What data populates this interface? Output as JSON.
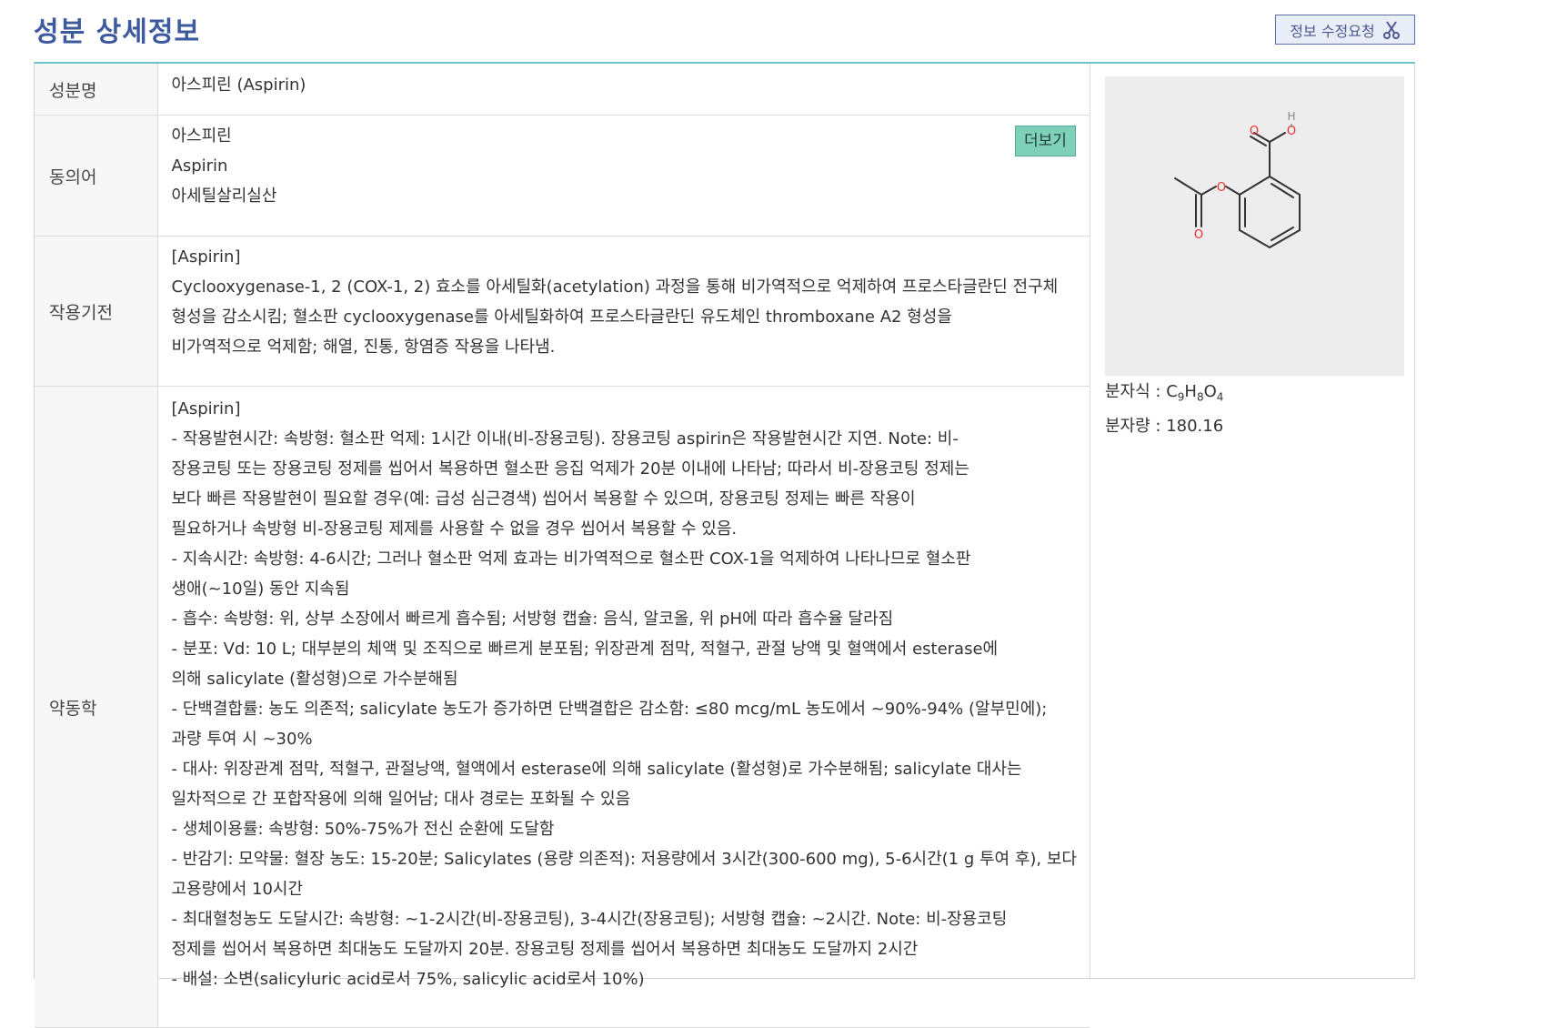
{
  "page": {
    "title": "성분 상세정보",
    "edit_button_label": "정보 수정요청"
  },
  "detail": {
    "name_label": "성분명",
    "name_value": "아스피린 (Aspirin)",
    "synonyms_label": "동의어",
    "synonyms": [
      "아스피린",
      "Aspirin",
      "아세틸살리실산"
    ],
    "more_button_label": "더보기",
    "mechanism_label": "작용기전",
    "mechanism_lines": [
      "[Aspirin]",
      "Cyclooxygenase-1, 2 (COX-1, 2) 효소를 아세틸화(acetylation) 과정을 통해 비가역적으로 억제하여 프로스타글란딘 전구체",
      "형성을 감소시킴; 혈소판 cyclooxygenase를 아세틸화하여 프로스타글란딘 유도체인 thromboxane A2 형성을",
      "비가역적으로 억제함; 해열, 진통, 항염증 작용을 나타냄."
    ],
    "pk_label": "약동학",
    "pk_lines": [
      "[Aspirin]",
      "- 작용발현시간: 속방형: 혈소판 억제: 1시간 이내(비-장용코팅). 장용코팅 aspirin은 작용발현시간 지연. Note: 비-",
      "장용코팅 또는 장용코팅 정제를 씹어서 복용하면 혈소판 응집 억제가 20분 이내에 나타남; 따라서 비-장용코팅 정제는",
      "보다 빠른 작용발현이 필요할 경우(예: 급성 심근경색) 씹어서 복용할 수 있으며, 장용코팅 정제는 빠른 작용이",
      "필요하거나 속방형 비-장용코팅 제제를 사용할 수 없을 경우 씹어서 복용할 수 있음.",
      "- 지속시간: 속방형: 4-6시간; 그러나 혈소판 억제 효과는 비가역적으로 혈소판 COX-1을 억제하여 나타나므로 혈소판",
      "생애(~10일) 동안 지속됨",
      "- 흡수: 속방형: 위, 상부 소장에서 빠르게 흡수됨; 서방형 캡슐: 음식, 알코올, 위 pH에 따라 흡수율 달라짐",
      "- 분포: Vd: 10 L; 대부분의 체액 및 조직으로 빠르게 분포됨; 위장관계 점막, 적혈구, 관절 낭액 및 혈액에서 esterase에",
      "의해 salicylate (활성형)으로 가수분해됨",
      "- 단백결합률: 농도 의존적; salicylate 농도가 증가하면 단백결합은 감소함: ≤80 mcg/mL 농도에서 ~90%-94% (알부민에);",
      "과량 투여 시 ~30%",
      "- 대사: 위장관계 점막, 적혈구, 관절낭액, 혈액에서 esterase에 의해 salicylate (활성형)로 가수분해됨; salicylate 대사는",
      "일차적으로 간 포합작용에 의해 일어남; 대사 경로는 포화될 수 있음",
      "- 생체이용률: 속방형: 50%-75%가 전신 순환에 도달함",
      "- 반감기: 모약물: 혈장 농도: 15-20분; Salicylates (용량 의존적): 저용량에서 3시간(300-600 mg), 5-6시간(1 g 투여 후), 보다",
      "고용량에서 10시간",
      "- 최대혈청농도 도달시간: 속방형: ~1-2시간(비-장용코팅), 3-4시간(장용코팅); 서방형 캡슐: ~2시간. Note: 비-장용코팅",
      "정제를 씹어서 복용하면 최대농도 도달까지 20분. 장용코팅 정제를 씹어서 복용하면 최대농도 도달까지 2시간",
      "- 배설: 소변(salicyluric acid로서 75%, salicylic acid로서 10%)"
    ]
  },
  "molecule": {
    "formula_label": "분자식 : ",
    "formula_parts": [
      {
        "text": "C",
        "sub": false
      },
      {
        "text": "9",
        "sub": true
      },
      {
        "text": "H",
        "sub": false
      },
      {
        "text": "8",
        "sub": true
      },
      {
        "text": "O",
        "sub": false
      },
      {
        "text": "4",
        "sub": true
      }
    ],
    "weight_label": "분자량 : ",
    "weight_value": "180.16",
    "atom_labels": {
      "oxygen": "O",
      "hydrogen": "H"
    },
    "colors": {
      "oxygen": "#e8312f",
      "hydrogen": "#888888",
      "bond": "#333333",
      "background": "#ededed"
    }
  },
  "theme": {
    "title_color": "#3d5a9e",
    "accent_border": "#6cc6c8",
    "more_button_bg": "#7fd0b9"
  }
}
